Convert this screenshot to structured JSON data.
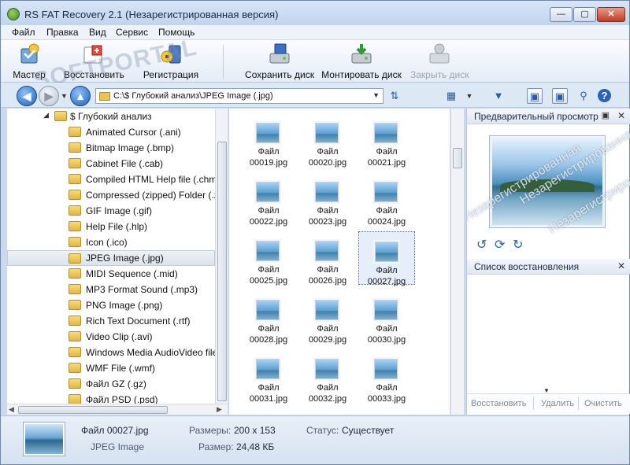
{
  "window": {
    "title": "RS FAT Recovery 2.1 (Незарегистрированная версия)",
    "min": "—",
    "max": "▢",
    "close": "✕"
  },
  "menu": [
    "Файл",
    "Правка",
    "Вид",
    "Сервис",
    "Помощь"
  ],
  "watermark": "SOFTPORTAL",
  "toolbar": {
    "wizard": "Мастер",
    "restore": "Восстановить",
    "register": "Регистрация",
    "save_disk": "Сохранить диск",
    "mount_disk": "Монтировать диск",
    "close_disk": "Закрыть диск"
  },
  "address": {
    "path": "C:\\$ Глубокий анализ\\JPEG Image (.jpg)"
  },
  "tree": {
    "root": "$ Глубокий анализ",
    "items": [
      "Animated Cursor (.ani)",
      "Bitmap Image (.bmp)",
      "Cabinet File (.cab)",
      "Compiled HTML Help file (.chm)",
      "Compressed (zipped) Folder (.zip)",
      "GIF Image (.gif)",
      "Help File (.hlp)",
      "Icon (.ico)",
      "JPEG Image (.jpg)",
      "MIDI Sequence (.mid)",
      "MP3 Format Sound (.mp3)",
      "PNG Image (.png)",
      "Rich Text Document (.rtf)",
      "Video Clip (.avi)",
      "Windows Media AudioVideo file (.wmv)",
      "WMF File (.wmf)",
      "Файл GZ (.gz)",
      "Файл PSD (.psd)"
    ],
    "selected": "JPEG Image (.jpg)"
  },
  "files": [
    {
      "l1": "Файл",
      "l2": "00019.jpg"
    },
    {
      "l1": "Файл",
      "l2": "00020.jpg"
    },
    {
      "l1": "Файл",
      "l2": "00021.jpg"
    },
    {
      "l1": "Файл",
      "l2": "00022.jpg"
    },
    {
      "l1": "Файл",
      "l2": "00023.jpg"
    },
    {
      "l1": "Файл",
      "l2": "00024.jpg"
    },
    {
      "l1": "Файл",
      "l2": "00025.jpg"
    },
    {
      "l1": "Файл",
      "l2": "00026.jpg"
    },
    {
      "l1": "Файл",
      "l2": "00027.jpg"
    },
    {
      "l1": "Файл",
      "l2": "00028.jpg"
    },
    {
      "l1": "Файл",
      "l2": "00029.jpg"
    },
    {
      "l1": "Файл",
      "l2": "00030.jpg"
    },
    {
      "l1": "Файл",
      "l2": "00031.jpg"
    },
    {
      "l1": "Файл",
      "l2": "00032.jpg"
    },
    {
      "l1": "Файл",
      "l2": "00033.jpg"
    }
  ],
  "selected_file": "00027.jpg",
  "preview": {
    "title": "Предварительный просмотр",
    "watermark_1": "Незарегистрированная",
    "watermark_2": "Незарегистрированная",
    "watermark_3": "Незарегистрирована"
  },
  "recovery": {
    "title": "Список восстановления",
    "restore": "Восстановить",
    "delete": "Удалить",
    "clear": "Очистить"
  },
  "status": {
    "name": "Файл 00027.jpg",
    "type": "JPEG Image",
    "dims_label": "Размеры:",
    "dims": "200 x 153",
    "size_label": "Размер:",
    "size": "24,48 КБ",
    "status_label": "Статус:",
    "status": "Существует"
  }
}
